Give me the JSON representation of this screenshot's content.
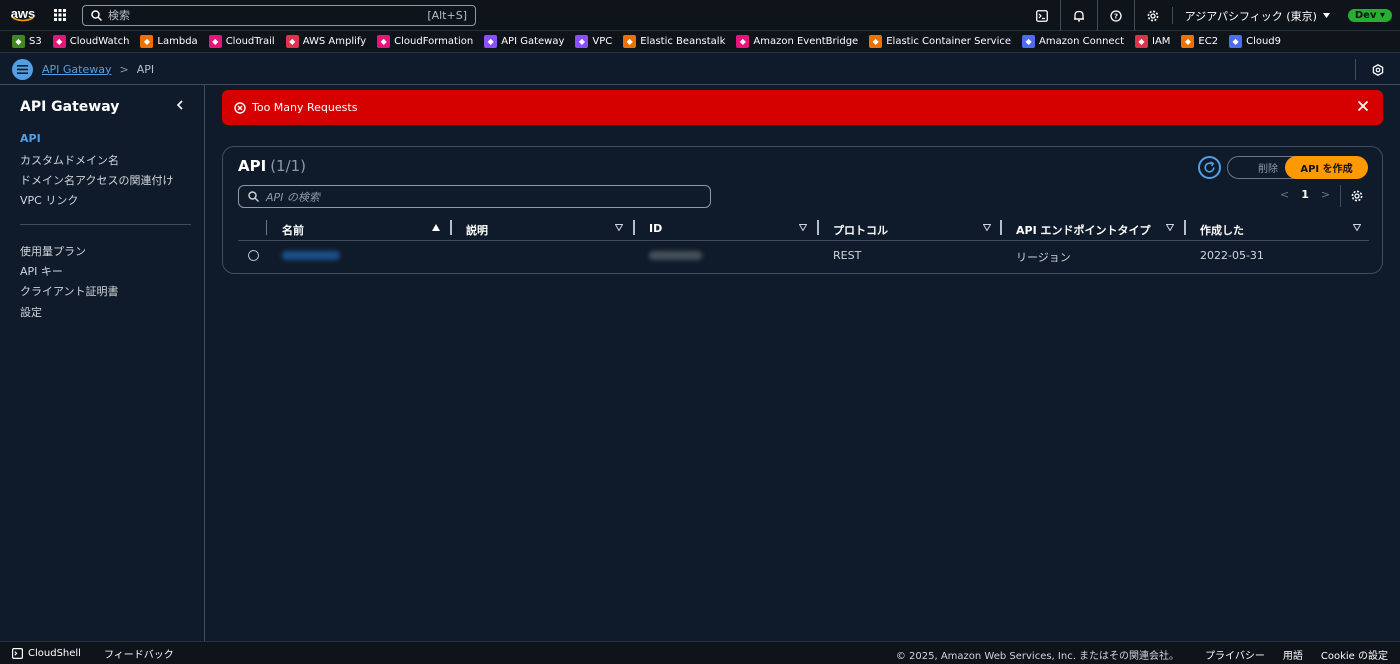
{
  "topbar": {
    "logo": "aws",
    "search_placeholder": "検索",
    "search_shortcut": "[Alt+S]",
    "region": "アジアパシフィック (東京)",
    "account_badge": "Dev"
  },
  "favorites": [
    {
      "label": "S3",
      "color": "#3f8624",
      "icon": "s3-icon"
    },
    {
      "label": "CloudWatch",
      "color": "#e7157b",
      "icon": "cloudwatch-icon"
    },
    {
      "label": "Lambda",
      "color": "#ed7100",
      "icon": "lambda-icon"
    },
    {
      "label": "CloudTrail",
      "color": "#e7157b",
      "icon": "cloudtrail-icon"
    },
    {
      "label": "AWS Amplify",
      "color": "#dd344c",
      "icon": "amplify-icon"
    },
    {
      "label": "CloudFormation",
      "color": "#e7157b",
      "icon": "cloudformation-icon"
    },
    {
      "label": "API Gateway",
      "color": "#8c4fff",
      "icon": "api-gateway-icon"
    },
    {
      "label": "VPC",
      "color": "#8c4fff",
      "icon": "vpc-icon"
    },
    {
      "label": "Elastic Beanstalk",
      "color": "#ed7100",
      "icon": "beanstalk-icon"
    },
    {
      "label": "Amazon EventBridge",
      "color": "#e7157b",
      "icon": "eventbridge-icon"
    },
    {
      "label": "Elastic Container Service",
      "color": "#ed7100",
      "icon": "ecs-icon"
    },
    {
      "label": "Amazon Connect",
      "color": "#4d6df0",
      "icon": "connect-icon"
    },
    {
      "label": "IAM",
      "color": "#dd344c",
      "icon": "iam-icon"
    },
    {
      "label": "EC2",
      "color": "#ed7100",
      "icon": "ec2-icon"
    },
    {
      "label": "Cloud9",
      "color": "#4d6df0",
      "icon": "cloud9-icon"
    }
  ],
  "breadcrumb": {
    "parent": "API Gateway",
    "current": "API"
  },
  "sidebar": {
    "title": "API Gateway",
    "group1": [
      "API",
      "カスタムドメイン名",
      "ドメイン名アクセスの関連付け",
      "VPC リンク"
    ],
    "group2": [
      "使用量プラン",
      "API キー",
      "クライアント証明書",
      "設定"
    ]
  },
  "alert": {
    "message": "Too Many Requests",
    "color": "#d50000"
  },
  "panel": {
    "title": "API",
    "count": "(1/1)",
    "delete_label": "削除",
    "create_label": "API を作成",
    "filter_placeholder": "API の検索",
    "page": "1"
  },
  "table": {
    "columns": [
      "名前",
      "説明",
      "ID",
      "プロトコル",
      "API エンドポイントタイプ",
      "作成した"
    ],
    "rows": [
      {
        "protocol": "REST",
        "endpoint_type": "リージョン",
        "created": "2022-05-31"
      }
    ]
  },
  "footer": {
    "cloudshell": "CloudShell",
    "feedback": "フィードバック",
    "copyright": "© 2025, Amazon Web Services, Inc. またはその関連会社。",
    "privacy": "プライバシー",
    "terms": "用語",
    "cookie": "Cookie の設定"
  }
}
